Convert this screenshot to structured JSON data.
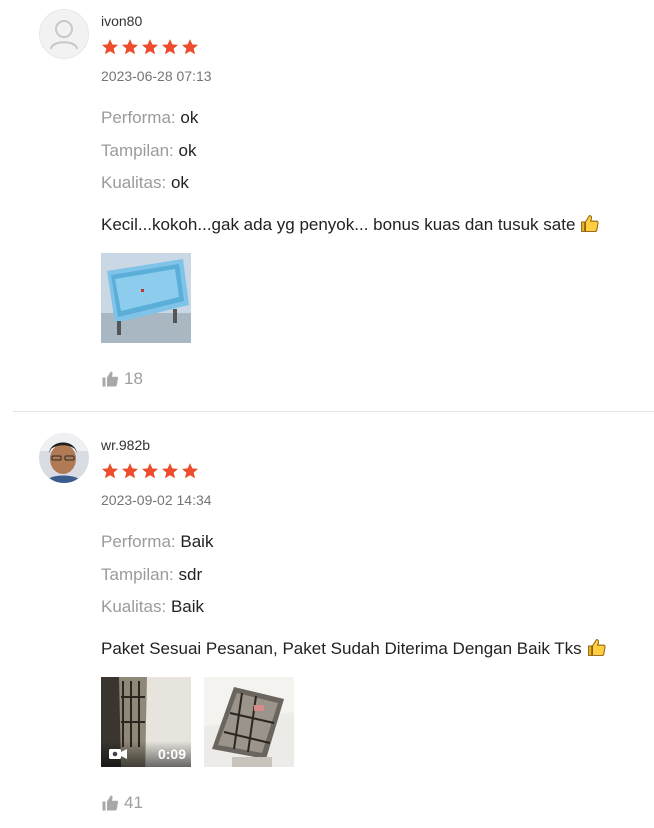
{
  "reviews": [
    {
      "username": "ivon80",
      "rating": 5,
      "datetime": "2023-06-28 07:13",
      "attributes": [
        {
          "key": "Performa:",
          "value": "ok"
        },
        {
          "key": "Tampilan:",
          "value": "ok"
        },
        {
          "key": "Kualitas:",
          "value": "ok"
        }
      ],
      "comment": "Kecil...kokoh...gak ada yg penyok... bonus kuas dan tusuk sate",
      "likes": "18"
    },
    {
      "username": "wr.982b",
      "rating": 5,
      "datetime": "2023-09-02 14:34",
      "attributes": [
        {
          "key": "Performa:",
          "value": "Baik"
        },
        {
          "key": "Tampilan:",
          "value": "sdr"
        },
        {
          "key": "Kualitas:",
          "value": "Baik"
        }
      ],
      "comment": "Paket Sesuai Pesanan, Paket Sudah Diterima Dengan Baik Tks",
      "video_duration": "0:09",
      "likes": "41"
    }
  ],
  "colors": {
    "star": "#ee4d2d",
    "muted": "#9b9b9b",
    "divider": "#e6e6e6",
    "like": "#9e9e9e"
  },
  "icons": {
    "rating": "star-icon",
    "like": "thumbs-up-icon",
    "video": "video-camera-icon",
    "emoji": "thumbs-up-emoji"
  }
}
